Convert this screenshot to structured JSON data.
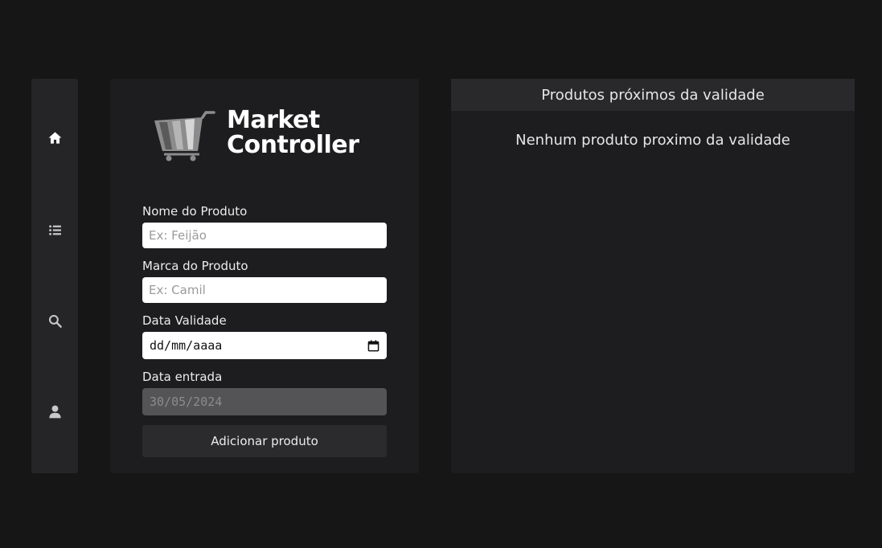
{
  "sidebar": {
    "items": [
      {
        "icon": "home-icon",
        "label": "home"
      },
      {
        "icon": "list-icon",
        "label": "list"
      },
      {
        "icon": "search-icon",
        "label": "search"
      },
      {
        "icon": "user-icon",
        "label": "user"
      }
    ],
    "active_color": "#ffffff",
    "icon_color": "#c8c8c8"
  },
  "logo": {
    "line1": "Market",
    "line2": "Controller"
  },
  "form": {
    "name_label": "Nome do Produto",
    "name_placeholder": "Ex: Feijão",
    "name_value": "",
    "brand_label": "Marca do Produto",
    "brand_placeholder": "Ex: Camil",
    "brand_value": "",
    "expiry_label": "Data Validade",
    "expiry_value": "dd/mm/aaaa",
    "entry_label": "Data entrada",
    "entry_value": "30/05/2024",
    "submit_label": "Adicionar produto"
  },
  "expiring": {
    "title": "Produtos próximos da validade",
    "empty_message": "Nenhum produto proximo da validade"
  }
}
